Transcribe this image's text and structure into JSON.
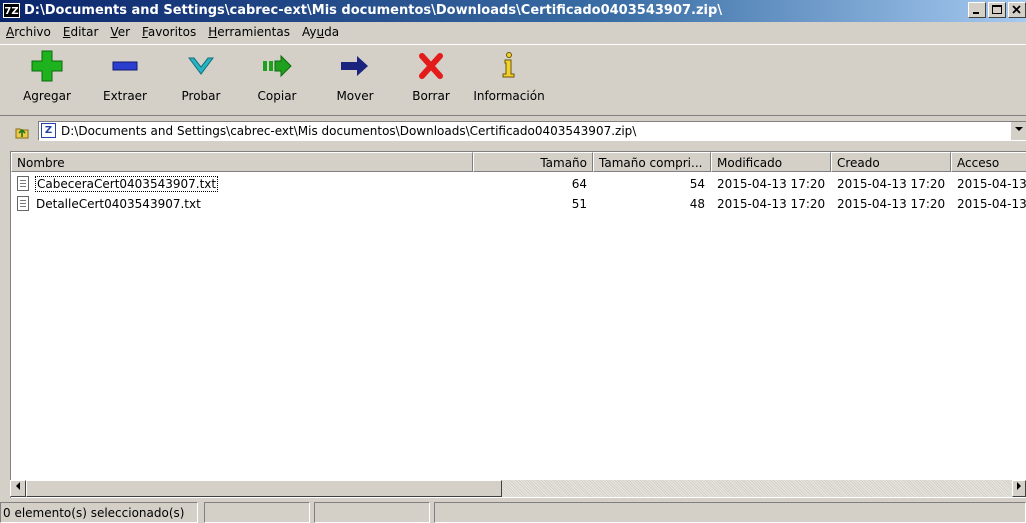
{
  "window": {
    "app_icon_text": "7Z",
    "title": "D:\\Documents and Settings\\cabrec-ext\\Mis documentos\\Downloads\\Certificado0403543907.zip\\"
  },
  "menu": [
    {
      "u": "A",
      "rest": "rchivo"
    },
    {
      "u": "E",
      "rest": "ditar"
    },
    {
      "u": "V",
      "rest": "er"
    },
    {
      "u": "F",
      "rest": "avoritos"
    },
    {
      "u": "H",
      "rest": "erramientas"
    },
    {
      "pre": "Ay",
      "u": "u",
      "rest": "da"
    }
  ],
  "toolbar": [
    {
      "label": "Agregar",
      "icon": "add-icon",
      "color": "#1fb21f"
    },
    {
      "label": "Extraer",
      "icon": "extract-icon",
      "color": "#2a3fd0"
    },
    {
      "label": "Probar",
      "icon": "test-icon",
      "color": "#27b3c3"
    },
    {
      "label": "Copiar",
      "icon": "copy-icon",
      "color": "#1fa01f"
    },
    {
      "label": "Mover",
      "icon": "move-icon",
      "color": "#1a237e"
    },
    {
      "label": "Borrar",
      "icon": "delete-icon",
      "color": "#e31b1b"
    },
    {
      "label": "Información",
      "icon": "info-icon",
      "color": "#b58900"
    }
  ],
  "address": {
    "path": "D:\\Documents and Settings\\cabrec-ext\\Mis documentos\\Downloads\\Certificado0403543907.zip\\"
  },
  "columns": [
    "Nombre",
    "Tamaño",
    "Tamaño compri...",
    "Modificado",
    "Creado",
    "Acceso"
  ],
  "files": [
    {
      "name": "CabeceraCert0403543907.txt",
      "size": "64",
      "packed": "54",
      "modified": "2015-04-13 17:20",
      "created": "2015-04-13 17:20",
      "accessed": "2015-04-13"
    },
    {
      "name": "DetalleCert0403543907.txt",
      "size": "51",
      "packed": "48",
      "modified": "2015-04-13 17:20",
      "created": "2015-04-13 17:20",
      "accessed": "2015-04-13"
    }
  ],
  "status": {
    "selection": "0 elemento(s) seleccionado(s)"
  }
}
